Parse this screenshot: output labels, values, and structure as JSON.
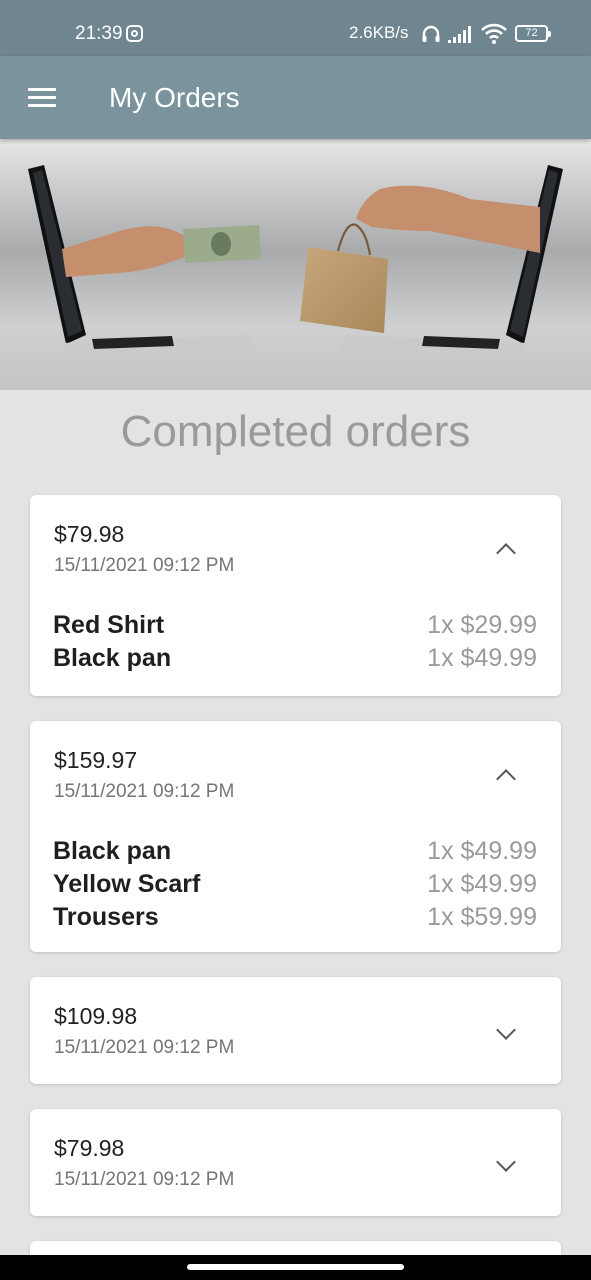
{
  "status_bar": {
    "time": "21:39",
    "net_speed": "2.6KB/s",
    "battery": "72",
    "icons": [
      "instagram-icon",
      "headset-icon",
      "signal-icon",
      "wifi-icon",
      "battery-icon"
    ]
  },
  "app_bar": {
    "title": "My Orders",
    "menu_icon": "menu-icon"
  },
  "section_title": "Completed orders",
  "orders": [
    {
      "total": "$79.98",
      "date": "15/11/2021 09:12 PM",
      "expanded": true,
      "items": [
        {
          "name": "Red Shirt",
          "qty_price": "1x $29.99"
        },
        {
          "name": "Black pan",
          "qty_price": "1x $49.99"
        }
      ]
    },
    {
      "total": "$159.97",
      "date": "15/11/2021 09:12 PM",
      "expanded": true,
      "items": [
        {
          "name": "Black pan",
          "qty_price": "1x $49.99"
        },
        {
          "name": "Yellow Scarf",
          "qty_price": "1x $49.99"
        },
        {
          "name": "Trousers",
          "qty_price": "1x $59.99"
        }
      ]
    },
    {
      "total": "$109.98",
      "date": "15/11/2021 09:12 PM",
      "expanded": false,
      "items": []
    },
    {
      "total": "$79.98",
      "date": "15/11/2021 09:12 PM",
      "expanded": false,
      "items": []
    }
  ],
  "colors": {
    "app_bar": "#7a939d",
    "status_bar": "#6f8590",
    "background": "#e3e3e3",
    "card": "#ffffff",
    "muted_text": "#9a9a9a"
  }
}
